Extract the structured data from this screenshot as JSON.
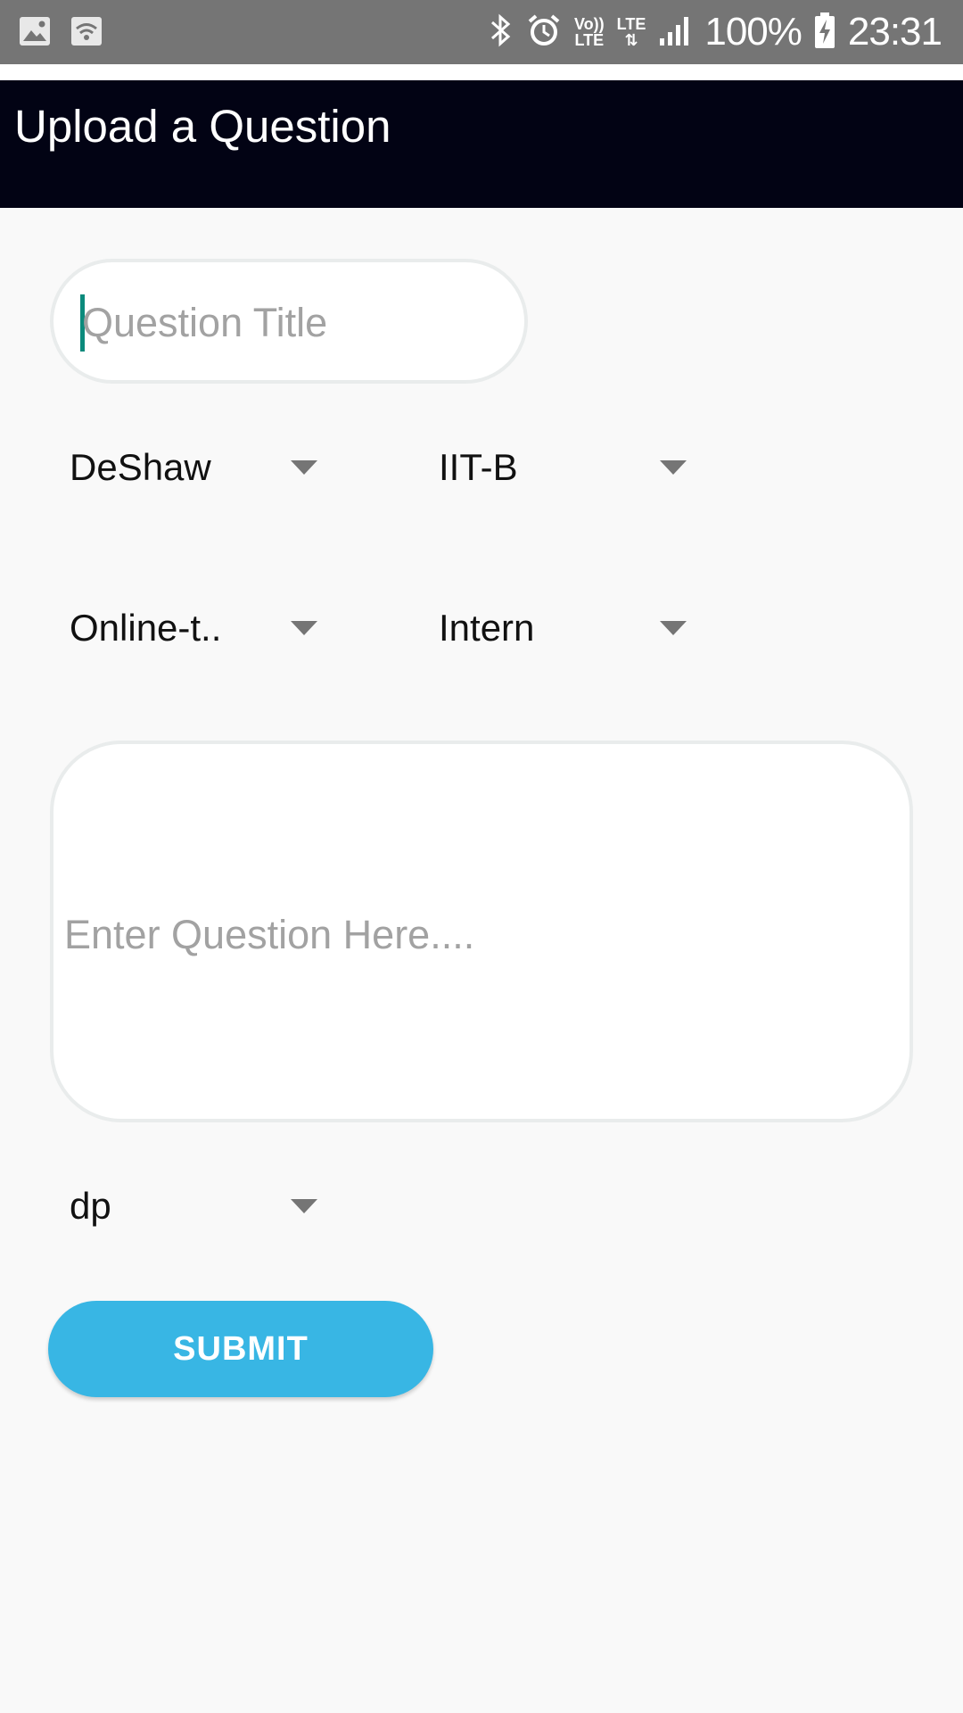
{
  "status_bar": {
    "battery": "100%",
    "time": "23:31",
    "volte_top": "Vo))",
    "volte_bottom": "LTE",
    "lte": "LTE"
  },
  "app_bar": {
    "title": "Upload a Question"
  },
  "form": {
    "title_placeholder": "Question Title",
    "company": "DeShaw",
    "college": "IIT-B",
    "round": "Online-t..",
    "position": "Intern",
    "question_placeholder": "Enter Question Here....",
    "topic": "dp",
    "submit_label": "SUBMIT"
  },
  "colors": {
    "app_bar": "#020314",
    "status_bar": "#757575",
    "accent": "#38b6e4",
    "cursor": "#0b8a7c"
  },
  "icons": {
    "status_left": [
      "image-icon",
      "wifi-hotspot-icon"
    ],
    "status_right": [
      "bluetooth-icon",
      "alarm-icon",
      "volte-icon",
      "lte-icon",
      "signal-icon",
      "battery-charging-icon"
    ]
  }
}
